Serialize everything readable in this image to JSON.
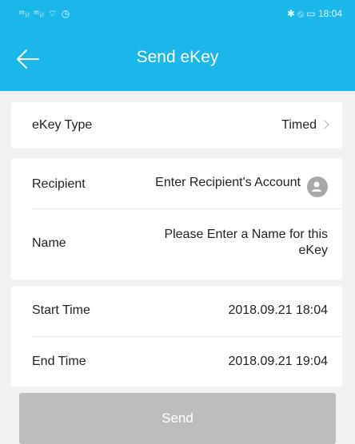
{
  "status_bar": {
    "left_icons": "ᵐᵢₗ ᵐᵢₗ ⌔ ◷",
    "right_icons": "✱ ⦸ ▭",
    "time": "18:04"
  },
  "header": {
    "title": "Send eKey",
    "back_icon": "arrow-left-icon"
  },
  "ekey_type": {
    "label": "eKey Type",
    "value": "Timed"
  },
  "recipient": {
    "label": "Recipient",
    "placeholder": "Enter Recipient's Account",
    "icon": "contact-icon"
  },
  "name": {
    "label": "Name",
    "placeholder_line1": "Please Enter a Name for this",
    "placeholder_line2": "eKey"
  },
  "start_time": {
    "label": "Start Time",
    "value": "2018.09.21 18:04"
  },
  "end_time": {
    "label": "End Time",
    "value": "2018.09.21 19:04"
  },
  "send_button": {
    "label": "Send"
  },
  "colors": {
    "header": "#1ab7ea",
    "background": "#f2f2f2",
    "button_disabled": "#bdbdbd",
    "placeholder": "#a9a9a9"
  }
}
